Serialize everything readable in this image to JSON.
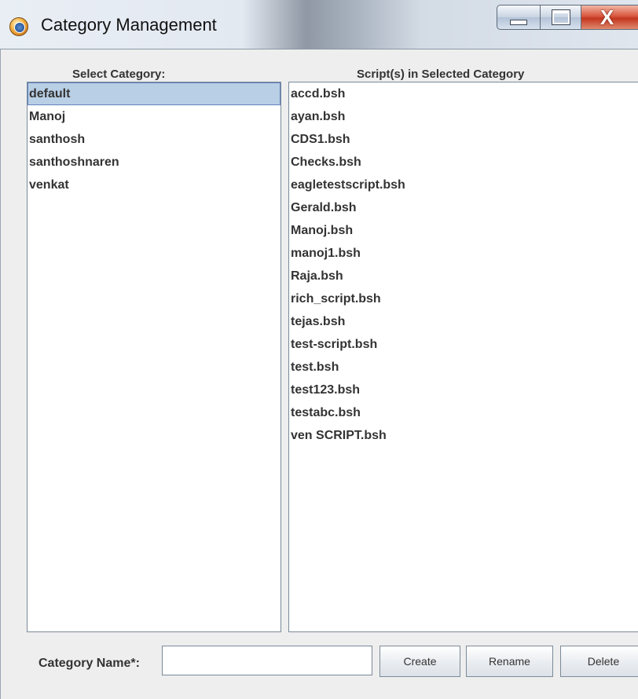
{
  "window": {
    "title": "Category Management",
    "controls": {
      "minimize": "minimize",
      "maximize": "maximize",
      "close": "X"
    }
  },
  "categories": {
    "header": "Select Category:",
    "selected_index": 0,
    "items": [
      "default",
      "Manoj",
      "santhosh",
      "santhoshnaren",
      "venkat"
    ]
  },
  "scripts": {
    "header": "Script(s) in Selected Category",
    "items": [
      "accd.bsh",
      "ayan.bsh",
      "CDS1.bsh",
      "Checks.bsh",
      "eagletestscript.bsh",
      "Gerald.bsh",
      "Manoj.bsh",
      "manoj1.bsh",
      "Raja.bsh",
      "rich_script.bsh",
      "tejas.bsh",
      "test-script.bsh",
      "test.bsh",
      "test123.bsh",
      "testabc.bsh",
      "ven SCRIPT.bsh"
    ]
  },
  "form": {
    "category_name_label": "Category Name*:",
    "category_name_value": "",
    "create_label": "Create",
    "rename_label": "Rename",
    "delete_label": "Delete"
  },
  "colors": {
    "selection_bg": "#b8cfe5",
    "selection_border": "#6382bf",
    "panel_bg": "#eeeeee"
  },
  "icons": {
    "app": "category-app-icon",
    "minimize": "minimize-icon",
    "maximize": "maximize-icon",
    "close": "close-icon"
  }
}
